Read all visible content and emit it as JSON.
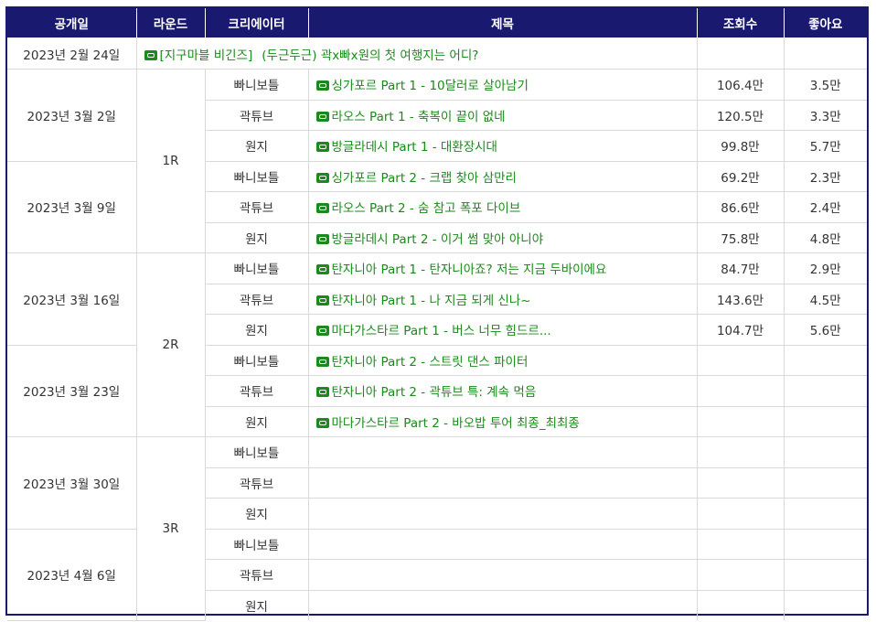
{
  "headers": [
    "공개일",
    "라운드",
    "크리에이터",
    "제목",
    "조회수",
    "좋아요"
  ],
  "intro": {
    "date": "2023년 2월 24일",
    "title_a": "[지구마블 비긴즈]",
    "title_b": "(두근두근) 곽x빠x원의 첫 여행지는 어디?"
  },
  "dates": [
    "2023년 3월 2일",
    "2023년 3월 9일",
    "2023년 3월 16일",
    "2023년 3월 23일",
    "2023년 3월 30일",
    "2023년 4월 6일"
  ],
  "rounds": [
    "1R",
    "2R",
    "3R"
  ],
  "rows": [
    {
      "creator": "빠니보틀",
      "title": "싱가포르 Part 1 - 10달러로 살아남기",
      "views": "106.4만",
      "likes": "3.5만"
    },
    {
      "creator": "곽튜브",
      "title": "라오스 Part 1 - 축복이 끝이 없네",
      "views": "120.5만",
      "likes": "3.3만"
    },
    {
      "creator": "원지",
      "title": "방글라데시 Part 1 - 대환장시대",
      "views": "99.8만",
      "likes": "5.7만"
    },
    {
      "creator": "빠니보틀",
      "title": "싱가포르 Part 2 - 크랩 찾아 삼만리",
      "views": "69.2만",
      "likes": "2.3만"
    },
    {
      "creator": "곽튜브",
      "title": "라오스 Part 2 - 숨 참고 폭포 다이브",
      "views": "86.6만",
      "likes": "2.4만"
    },
    {
      "creator": "원지",
      "title": "방글라데시 Part 2 - 이거 썸 맞아 아니야",
      "views": "75.8만",
      "likes": "4.8만"
    },
    {
      "creator": "빠니보틀",
      "title": "탄자니아 Part 1 - 탄자니아죠? 저는 지금 두바이에요",
      "views": "84.7만",
      "likes": "2.9만"
    },
    {
      "creator": "곽튜브",
      "title": "탄자니아 Part 1 - 나 지금 되게 신나~",
      "views": "143.6만",
      "likes": "4.5만"
    },
    {
      "creator": "원지",
      "title": "마다가스타르 Part 1 - 버스 너무 힘드르...",
      "views": "104.7만",
      "likes": "5.6만"
    },
    {
      "creator": "빠니보틀",
      "title": "탄자니아 Part 2 - 스트릿 댄스 파이터",
      "views": "",
      "likes": ""
    },
    {
      "creator": "곽튜브",
      "title": "탄자니아 Part 2 - 곽튜브 특: 계속 먹음",
      "views": "",
      "likes": ""
    },
    {
      "creator": "원지",
      "title": "마다가스타르 Part 2 - 바오밥 투어 최종_최최종",
      "views": "",
      "likes": ""
    },
    {
      "creator": "빠니보틀",
      "title": "",
      "views": "",
      "likes": ""
    },
    {
      "creator": "곽튜브",
      "title": "",
      "views": "",
      "likes": ""
    },
    {
      "creator": "원지",
      "title": "",
      "views": "",
      "likes": ""
    },
    {
      "creator": "빠니보틀",
      "title": "",
      "views": "",
      "likes": ""
    },
    {
      "creator": "곽튜브",
      "title": "",
      "views": "",
      "likes": ""
    },
    {
      "creator": "원지",
      "title": "",
      "views": "",
      "likes": ""
    }
  ],
  "colors": {
    "header_bg": "#191970",
    "link": "#1a8a1a"
  }
}
